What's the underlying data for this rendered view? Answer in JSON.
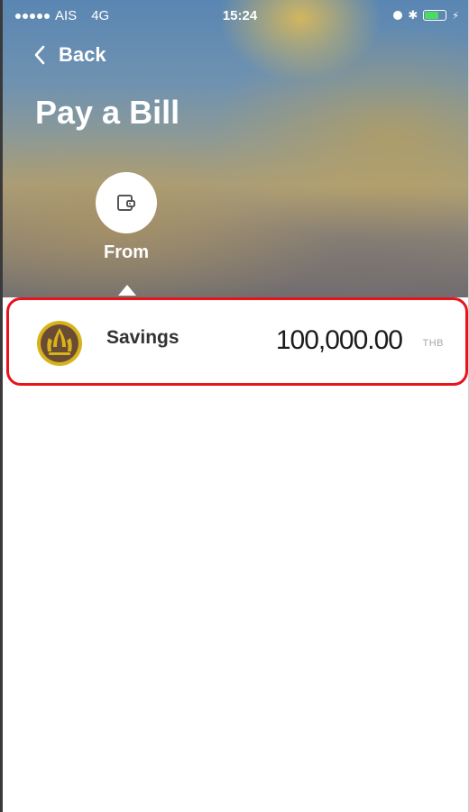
{
  "status_bar": {
    "carrier": "AIS",
    "network": "4G",
    "time": "15:24"
  },
  "nav": {
    "back_label": "Back"
  },
  "page": {
    "title": "Pay a Bill"
  },
  "step": {
    "label": "From",
    "icon": "wallet-icon"
  },
  "account": {
    "name": "Savings",
    "amount": "100,000.00",
    "currency": "THB",
    "logo": "bank-logo-icon"
  },
  "colors": {
    "highlight_border": "#e8131b",
    "logo_gold": "#d8b21a",
    "logo_dark": "#6a4c35"
  }
}
